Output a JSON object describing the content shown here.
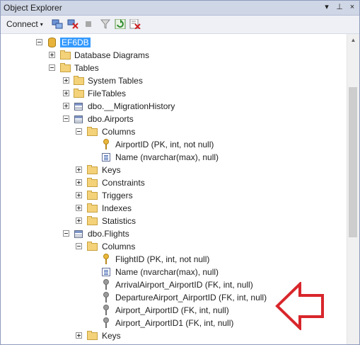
{
  "window": {
    "title": "Object Explorer",
    "pin_glyph": "▾",
    "autohide_glyph": "⊥",
    "close_glyph": "×"
  },
  "toolbar": {
    "connect_label": "Connect",
    "caret": "▾"
  },
  "tree": {
    "db": "EF6DB",
    "database_diagrams": "Database Diagrams",
    "tables": "Tables",
    "system_tables": "System Tables",
    "file_tables": "FileTables",
    "migration_history": "dbo.__MigrationHistory",
    "airports": {
      "label": "dbo.Airports",
      "columns_label": "Columns",
      "columns": [
        "AirportID (PK, int, not null)",
        "Name (nvarchar(max), null)"
      ],
      "folders": [
        "Keys",
        "Constraints",
        "Triggers",
        "Indexes",
        "Statistics"
      ]
    },
    "flights": {
      "label": "dbo.Flights",
      "columns_label": "Columns",
      "columns": [
        "FlightID (PK, int, not null)",
        "Name (nvarchar(max), null)",
        "ArrivalAirport_AirportID (FK, int, null)",
        "DepartureAirport_AirportID (FK, int, null)",
        "Airport_AirportID (FK, int, null)",
        "Airport_AirportID1 (FK, int, null)"
      ],
      "keys_label": "Keys"
    }
  },
  "colors": {
    "selection": "#3399ff",
    "arrow": "#d8262b",
    "folder": "#f3d27a"
  }
}
